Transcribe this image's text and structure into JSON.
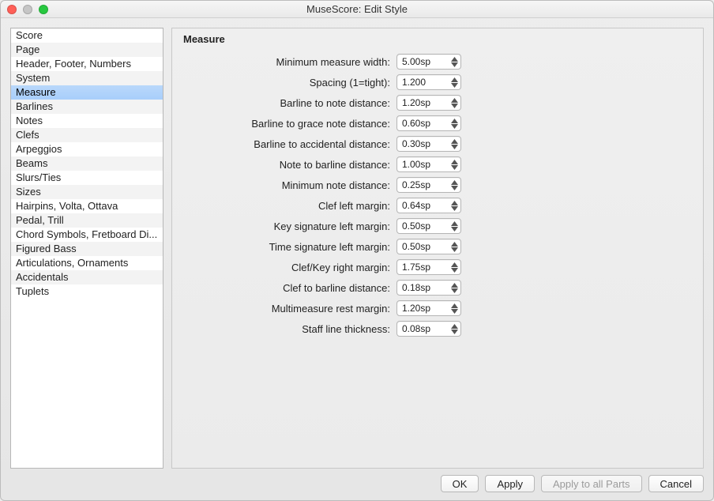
{
  "window": {
    "title": "MuseScore: Edit Style"
  },
  "sidebar": {
    "items": [
      {
        "label": "Score"
      },
      {
        "label": "Page"
      },
      {
        "label": "Header, Footer, Numbers"
      },
      {
        "label": "System"
      },
      {
        "label": "Measure",
        "selected": true
      },
      {
        "label": "Barlines"
      },
      {
        "label": "Notes"
      },
      {
        "label": "Clefs"
      },
      {
        "label": "Arpeggios"
      },
      {
        "label": "Beams"
      },
      {
        "label": "Slurs/Ties"
      },
      {
        "label": "Sizes"
      },
      {
        "label": "Hairpins, Volta, Ottava"
      },
      {
        "label": "Pedal, Trill"
      },
      {
        "label": "Chord Symbols, Fretboard Di..."
      },
      {
        "label": "Figured Bass"
      },
      {
        "label": "Articulations, Ornaments"
      },
      {
        "label": "Accidentals"
      },
      {
        "label": "Tuplets"
      }
    ]
  },
  "panel": {
    "title": "Measure",
    "settings": [
      {
        "label": "Minimum measure width:",
        "value": "5.00sp"
      },
      {
        "label": "Spacing (1=tight):",
        "value": "1.200"
      },
      {
        "label": "Barline to note distance:",
        "value": "1.20sp"
      },
      {
        "label": "Barline to grace note distance:",
        "value": "0.60sp"
      },
      {
        "label": "Barline to accidental distance:",
        "value": "0.30sp"
      },
      {
        "label": "Note to barline distance:",
        "value": "1.00sp"
      },
      {
        "label": "Minimum note distance:",
        "value": "0.25sp"
      },
      {
        "label": "Clef left margin:",
        "value": "0.64sp"
      },
      {
        "label": "Key signature left margin:",
        "value": "0.50sp"
      },
      {
        "label": "Time signature left margin:",
        "value": "0.50sp"
      },
      {
        "label": "Clef/Key right margin:",
        "value": "1.75sp"
      },
      {
        "label": "Clef to barline distance:",
        "value": "0.18sp"
      },
      {
        "label": "Multimeasure rest margin:",
        "value": "1.20sp"
      },
      {
        "label": "Staff line thickness:",
        "value": "0.08sp"
      }
    ]
  },
  "footer": {
    "ok": "OK",
    "apply": "Apply",
    "apply_all": "Apply to all Parts",
    "cancel": "Cancel"
  }
}
